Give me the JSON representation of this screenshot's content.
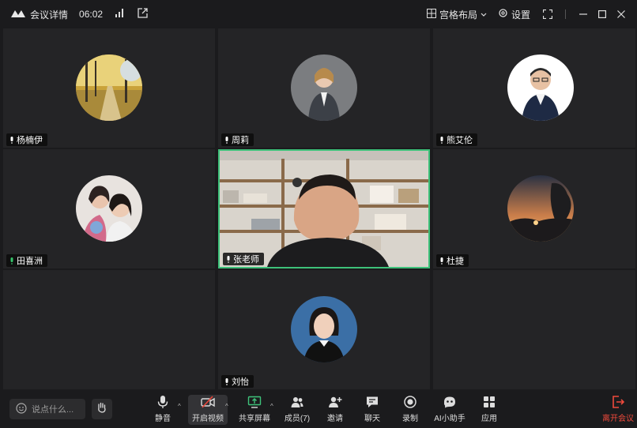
{
  "titlebar": {
    "meeting_details": "会议详情",
    "duration": "06:02",
    "layout_label": "宫格布局",
    "settings_label": "设置"
  },
  "participants": [
    {
      "name": "杨楠伊",
      "mic": "muted"
    },
    {
      "name": "周莉",
      "mic": "muted"
    },
    {
      "name": "熊艾伦",
      "mic": "muted"
    },
    {
      "name": "田喜洲",
      "mic": "active"
    },
    {
      "name": "张老师",
      "mic": "muted",
      "video": true
    },
    {
      "name": "杜捷",
      "mic": "muted"
    },
    {
      "name": "刘怡",
      "mic": "muted"
    }
  ],
  "toolbar": {
    "chat_placeholder": "说点什么...",
    "mute": "静音",
    "start_video": "开启视频",
    "share_screen": "共享屏幕",
    "members": "成员(7)",
    "invite": "邀请",
    "chat": "聊天",
    "record": "录制",
    "ai_assistant": "AI小助手",
    "apps": "应用",
    "leave": "离开会议"
  },
  "colors": {
    "active_speaker_border": "#3ec27a",
    "leave": "#ef4a3c",
    "active_mic": "#35c46b"
  }
}
